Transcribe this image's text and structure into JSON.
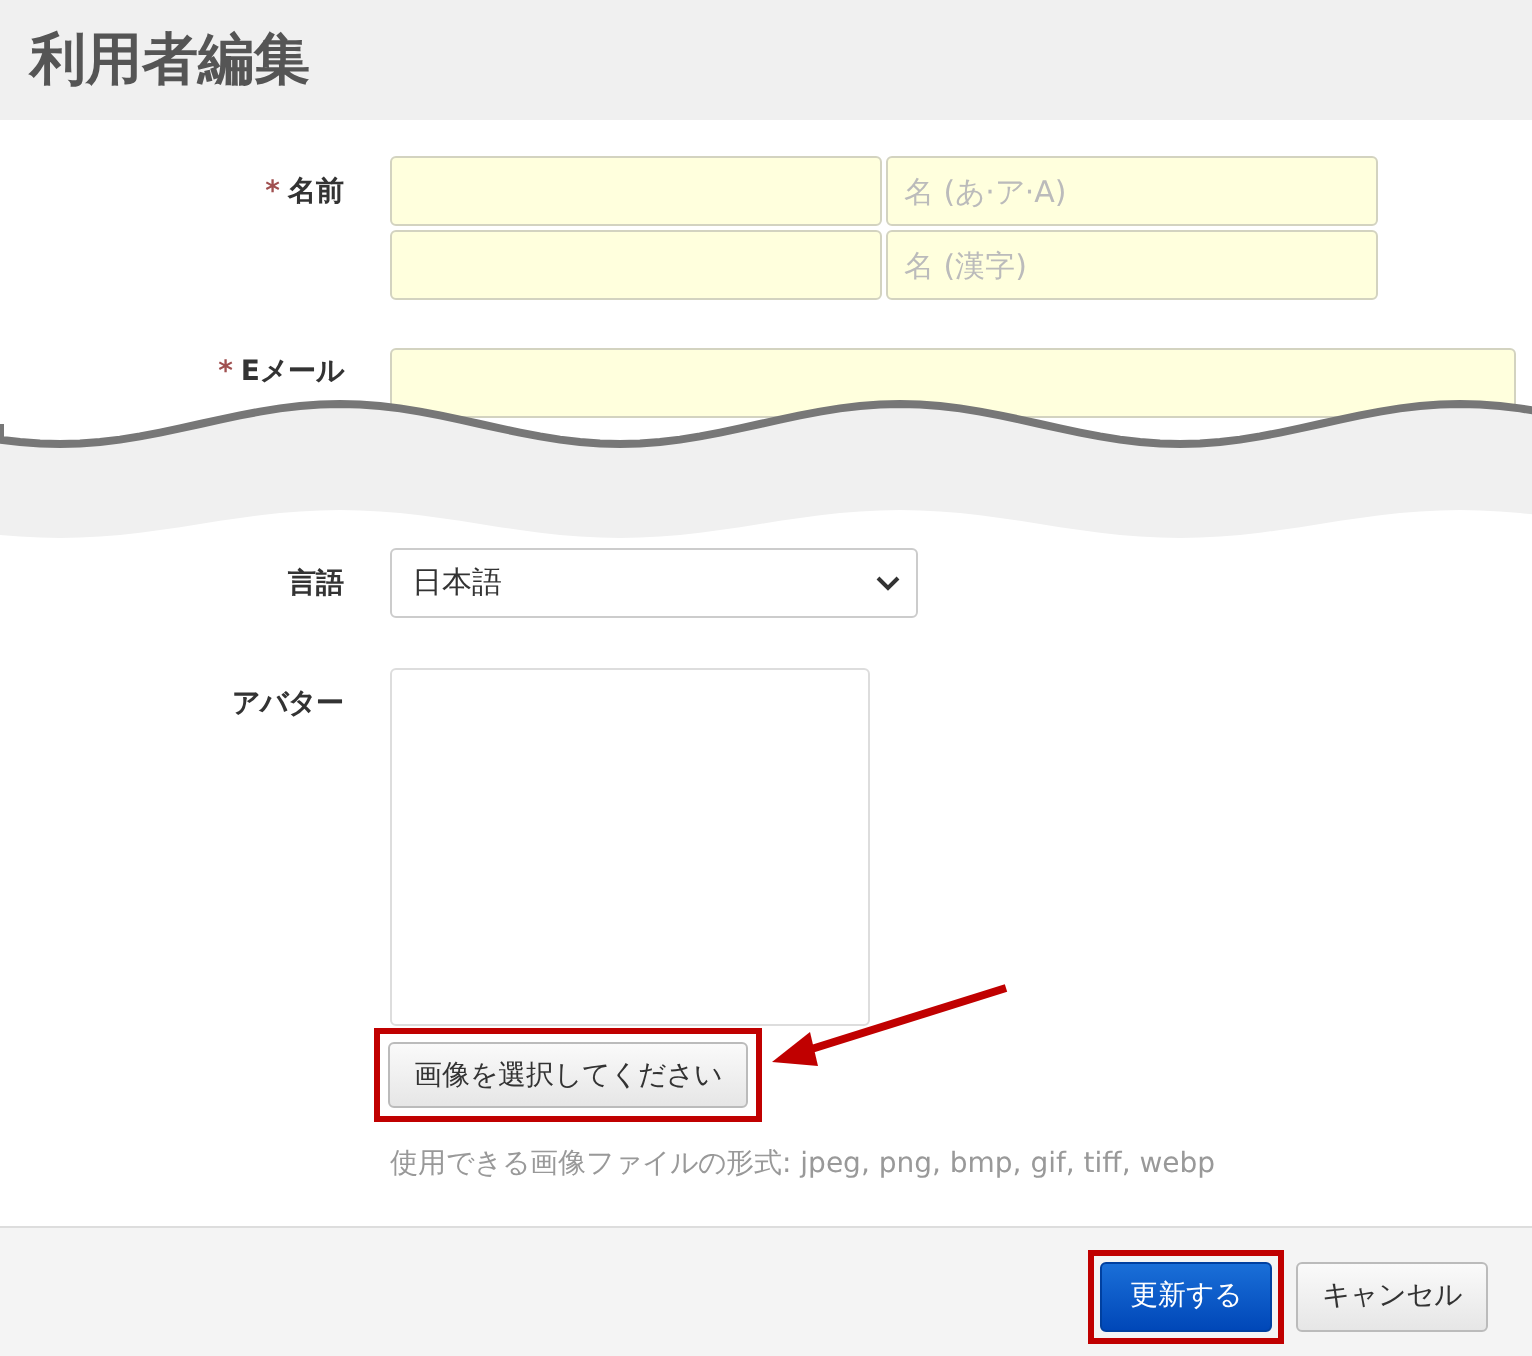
{
  "header": {
    "title": "利用者編集"
  },
  "name": {
    "label": "名前",
    "marker": "*",
    "reading_placeholder": "名 (あ·ア·A)",
    "kanji_placeholder": "名 (漢字)"
  },
  "email": {
    "label": "Eメール",
    "marker": "*"
  },
  "language": {
    "label": "言語",
    "value": "日本語"
  },
  "avatar": {
    "label": "アバター",
    "button": {
      "label": "画像を選択してください",
      "highlighted": true
    },
    "hint": "使用できる画像ファイルの形式: jpeg, png, bmp, gif, tiff, webp"
  },
  "footer": {
    "buttons": [
      {
        "label": "更新する",
        "kind": "primary",
        "highlighted": true
      },
      {
        "label": "キャンセル",
        "kind": "default",
        "highlighted": false
      }
    ]
  }
}
